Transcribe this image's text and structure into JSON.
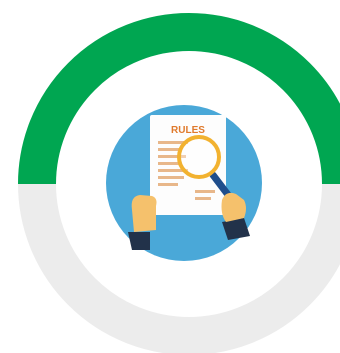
{
  "graphic": {
    "progress": 0.5,
    "colors": {
      "track": "#ececec",
      "progress": "#00a651",
      "badge": "#4aa8d8",
      "paper": "#fdfdfd",
      "text_lines": "#e8b78a",
      "magnifier": "#f2b230",
      "handle": "#1f4e8c",
      "skin": "#f5c16c",
      "sleeve": "#22324a"
    },
    "icon": "rules-review-icon",
    "document_title": "RULES"
  }
}
